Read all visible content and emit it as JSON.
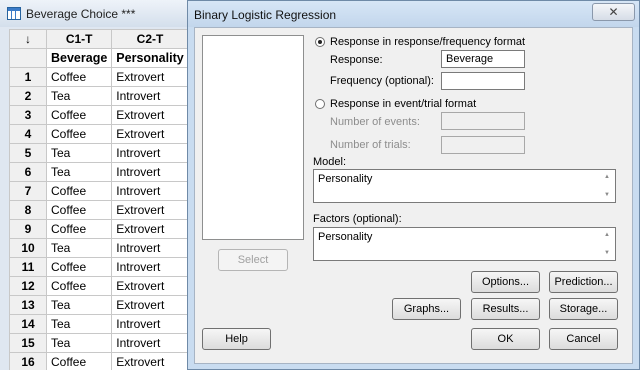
{
  "worksheet": {
    "title": "Beverage Choice ***",
    "header_arrow": "↓",
    "columns": [
      {
        "id": "C1-T",
        "name": "Beverage"
      },
      {
        "id": "C2-T",
        "name": "Personality"
      }
    ],
    "rows": [
      {
        "n": "1",
        "beverage": "Coffee",
        "personality": "Extrovert"
      },
      {
        "n": "2",
        "beverage": "Tea",
        "personality": "Introvert"
      },
      {
        "n": "3",
        "beverage": "Coffee",
        "personality": "Extrovert"
      },
      {
        "n": "4",
        "beverage": "Coffee",
        "personality": "Extrovert"
      },
      {
        "n": "5",
        "beverage": "Tea",
        "personality": "Introvert"
      },
      {
        "n": "6",
        "beverage": "Tea",
        "personality": "Introvert"
      },
      {
        "n": "7",
        "beverage": "Coffee",
        "personality": "Introvert"
      },
      {
        "n": "8",
        "beverage": "Coffee",
        "personality": "Extrovert"
      },
      {
        "n": "9",
        "beverage": "Coffee",
        "personality": "Extrovert"
      },
      {
        "n": "10",
        "beverage": "Tea",
        "personality": "Introvert"
      },
      {
        "n": "11",
        "beverage": "Coffee",
        "personality": "Introvert"
      },
      {
        "n": "12",
        "beverage": "Coffee",
        "personality": "Extrovert"
      },
      {
        "n": "13",
        "beverage": "Tea",
        "personality": "Extrovert"
      },
      {
        "n": "14",
        "beverage": "Tea",
        "personality": "Introvert"
      },
      {
        "n": "15",
        "beverage": "Tea",
        "personality": "Introvert"
      },
      {
        "n": "16",
        "beverage": "Coffee",
        "personality": "Extrovert"
      }
    ]
  },
  "dialog": {
    "title": "Binary Logistic Regression",
    "close_label": "✕",
    "select_label": "Select",
    "response_format": {
      "label": "Response in response/frequency format",
      "selected": true,
      "response_label": "Response:",
      "response_value": "Beverage",
      "frequency_label": "Frequency (optional):",
      "frequency_value": ""
    },
    "event_format": {
      "label": "Response in event/trial format",
      "selected": false,
      "events_label": "Number of events:",
      "events_value": "",
      "trials_label": "Number of trials:",
      "trials_value": ""
    },
    "model": {
      "label": "Model:",
      "value": "Personality"
    },
    "factors": {
      "label": "Factors (optional):",
      "value": "Personality"
    },
    "buttons": {
      "options": "Options...",
      "prediction": "Prediction...",
      "graphs": "Graphs...",
      "results": "Results...",
      "storage": "Storage...",
      "help": "Help",
      "ok": "OK",
      "cancel": "Cancel"
    }
  }
}
